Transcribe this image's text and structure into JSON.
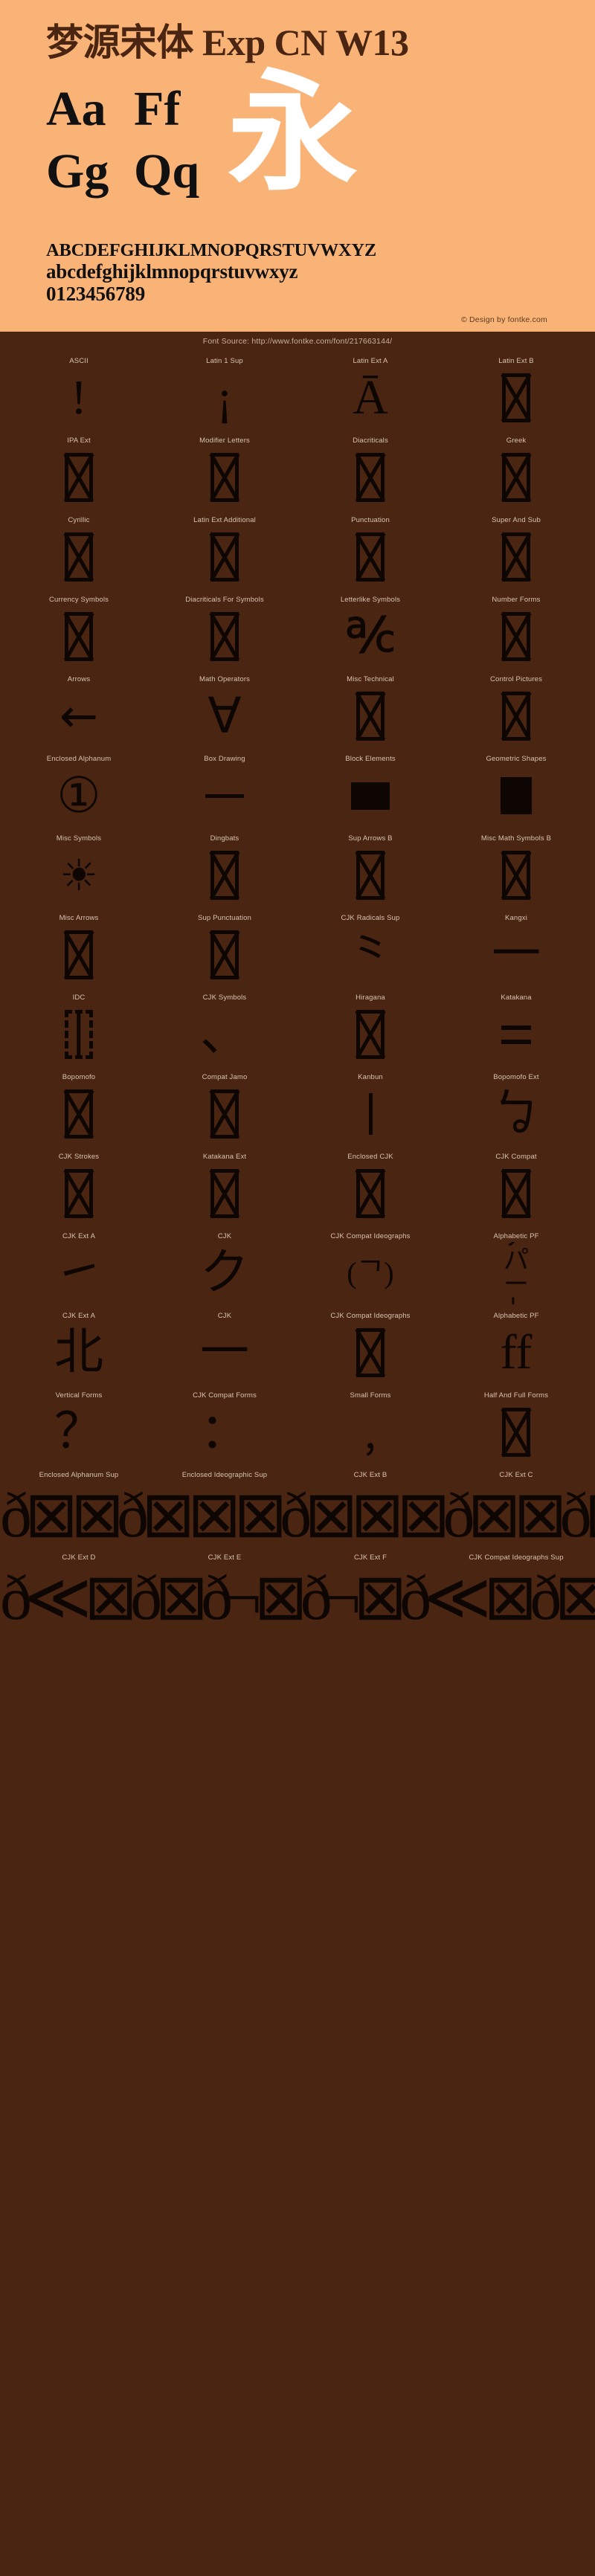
{
  "header": {
    "title": "梦源宋体 Exp CN W13",
    "samples": [
      [
        "Aa",
        "Gg"
      ],
      [
        "Ff",
        "Qq"
      ]
    ],
    "cjk_sample": "永",
    "alphabet_upper": "ABCDEFGHIJKLMNOPQRSTUVWXYZ",
    "alphabet_lower": "abcdefghijklmnopqrstuvwxyz",
    "digits": "0123456789",
    "design_credit": "© Design by fontke.com",
    "bg_color": "#F9B377",
    "title_color": "#4A2512"
  },
  "source_bar": {
    "text": "Font Source: http://www.fontke.com/font/217663144/"
  },
  "theme": {
    "body_bg": "#4A2512",
    "glyph_color": "#0D0603",
    "label_color": "#D8C3B2"
  },
  "blocks": [
    {
      "label": "ASCII",
      "glyph": "!",
      "kind": "glyph"
    },
    {
      "label": "Latin 1 Sup",
      "glyph": "¡",
      "kind": "glyph"
    },
    {
      "label": "Latin Ext A",
      "glyph": "Ā",
      "kind": "glyph"
    },
    {
      "label": "Latin Ext B",
      "glyph": "",
      "kind": "notdef"
    },
    {
      "label": "IPA Ext",
      "glyph": "",
      "kind": "notdef"
    },
    {
      "label": "Modifier Letters",
      "glyph": "",
      "kind": "notdef"
    },
    {
      "label": "Diacriticals",
      "glyph": "",
      "kind": "notdef"
    },
    {
      "label": "Greek",
      "glyph": "",
      "kind": "notdef"
    },
    {
      "label": "Cyrillic",
      "glyph": "",
      "kind": "notdef"
    },
    {
      "label": "Latin Ext Additional",
      "glyph": "",
      "kind": "notdef"
    },
    {
      "label": "Punctuation",
      "glyph": "",
      "kind": "notdef"
    },
    {
      "label": "Super And Sub",
      "glyph": "",
      "kind": "notdef"
    },
    {
      "label": "Currency Symbols",
      "glyph": "",
      "kind": "notdef"
    },
    {
      "label": "Diacriticals For Symbols",
      "glyph": "",
      "kind": "notdef"
    },
    {
      "label": "Letterlike Symbols",
      "glyph": "℀",
      "kind": "glyph"
    },
    {
      "label": "Number Forms",
      "glyph": "",
      "kind": "notdef"
    },
    {
      "label": "Arrows",
      "glyph": "←",
      "kind": "arrow"
    },
    {
      "label": "Math Operators",
      "glyph": "∀",
      "kind": "sans"
    },
    {
      "label": "Misc Technical",
      "glyph": "",
      "kind": "notdef"
    },
    {
      "label": "Control Pictures",
      "glyph": "",
      "kind": "notdef"
    },
    {
      "label": "Enclosed Alphanum",
      "glyph": "①",
      "kind": "sans"
    },
    {
      "label": "Box Drawing",
      "glyph": "─",
      "kind": "hline"
    },
    {
      "label": "Block Elements",
      "glyph": "█",
      "kind": "solid-block"
    },
    {
      "label": "Geometric Shapes",
      "glyph": "■",
      "kind": "solid-square"
    },
    {
      "label": "Misc Symbols",
      "glyph": "☀",
      "kind": "sun"
    },
    {
      "label": "Dingbats",
      "glyph": "",
      "kind": "notdef"
    },
    {
      "label": "Sup Arrows B",
      "glyph": "",
      "kind": "notdef"
    },
    {
      "label": "Misc Math Symbols B",
      "glyph": "",
      "kind": "notdef"
    },
    {
      "label": "Misc Arrows",
      "glyph": "",
      "kind": "notdef"
    },
    {
      "label": "Sup Punctuation",
      "glyph": "",
      "kind": "notdef"
    },
    {
      "label": "CJK Radicals Sup",
      "glyph": "⺀",
      "kind": "glyph"
    },
    {
      "label": "Kangxi",
      "glyph": "⼀",
      "kind": "glyph"
    },
    {
      "label": "IDC",
      "glyph": "⿰",
      "kind": "notdef-dashed"
    },
    {
      "label": "CJK Symbols",
      "glyph": "、",
      "kind": "glyph"
    },
    {
      "label": "Hiragana",
      "glyph": "",
      "kind": "notdef"
    },
    {
      "label": "Katakana",
      "glyph": "゠",
      "kind": "eqline"
    },
    {
      "label": "Bopomofo",
      "glyph": "",
      "kind": "notdef"
    },
    {
      "label": "Compat Jamo",
      "glyph": "",
      "kind": "notdef"
    },
    {
      "label": "Kanbun",
      "glyph": "丨",
      "kind": "vline"
    },
    {
      "label": "Bopomofo Ext",
      "glyph": "ㆠ",
      "kind": "glyph"
    },
    {
      "label": "CJK Strokes",
      "glyph": "",
      "kind": "notdef"
    },
    {
      "label": "Katakana Ext",
      "glyph": "",
      "kind": "notdef"
    },
    {
      "label": "Enclosed CJK",
      "glyph": "",
      "kind": "notdef"
    },
    {
      "label": "CJK Compat",
      "glyph": "",
      "kind": "notdef"
    },
    {
      "label": "CJK Ext A",
      "glyph": "㇀",
      "kind": "glyph"
    },
    {
      "label": "CJK",
      "glyph": "ク",
      "kind": "glyph"
    },
    {
      "label": "CJK Compat Ideographs",
      "glyph": "(ᄀ)",
      "kind": "glyph"
    },
    {
      "label": "Alphabetic PF",
      "glyph": "アパート",
      "kind": "stack"
    },
    {
      "label": "CJK Ext A",
      "glyph": "北",
      "kind": "glyph"
    },
    {
      "label": "CJK",
      "glyph": "一",
      "kind": "glyph"
    },
    {
      "label": "CJK Compat Ideographs",
      "glyph": "",
      "kind": "notdef"
    },
    {
      "label": "Alphabetic PF",
      "glyph": "ff",
      "kind": "glyph"
    },
    {
      "label": "Vertical Forms",
      "glyph": "？",
      "kind": "glyph"
    },
    {
      "label": "CJK Compat Forms",
      "glyph": "：",
      "kind": "glyph"
    },
    {
      "label": "Small Forms",
      "glyph": "﹐",
      "kind": "glyph"
    },
    {
      "label": "Half And Full Forms",
      "glyph": "",
      "kind": "notdef"
    }
  ],
  "wide_panels": [
    {
      "labels": [
        "Enclosed Alphanum Sup",
        "Enclosed Ideographic Sup",
        "CJK Ext B",
        "CJK Ext C"
      ],
      "content": "ð⊠⊠ð⊠⊠⊠ð⊠⊠⊠ð⊠⊠"
    },
    {
      "labels": [
        "CJK Ext D",
        "CJK Ext E",
        "CJK Ext F",
        "CJK Compat Ideographs Sup"
      ],
      "content": "ð≪⊠ð⊠ð¬⊠ð¬⊠"
    }
  ]
}
